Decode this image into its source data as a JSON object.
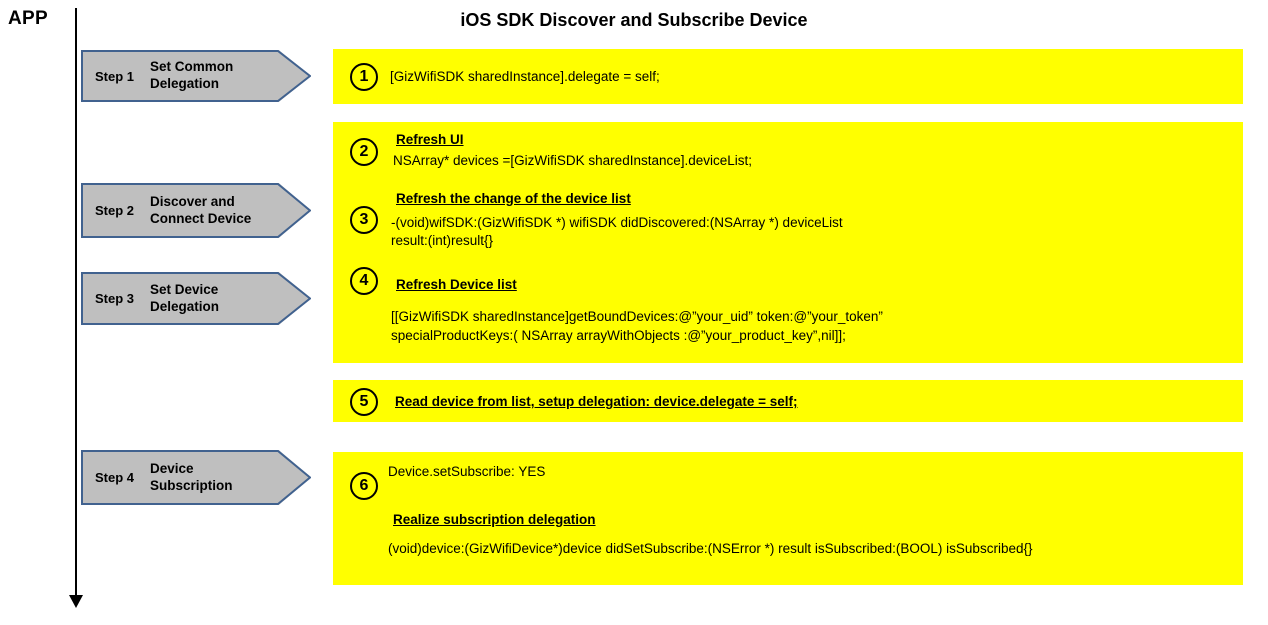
{
  "title": "iOS SDK Discover and Subscribe Device",
  "actor": {
    "label": "APP"
  },
  "colors": {
    "panel_background": "#ffff00",
    "chevron_fill": "#bfbfbf",
    "chevron_border": "#41628f",
    "text": "#000000",
    "lifeline": "#000000"
  },
  "steps": [
    {
      "number": "Step 1",
      "name": "Set Common\nDelegation"
    },
    {
      "number": "Step 2",
      "name": "Discover and\nConnect Device"
    },
    {
      "number": "Step 3",
      "name": "Set Device\nDelegation"
    },
    {
      "number": "Step 4",
      "name": "Device\nSubscription"
    }
  ],
  "panels": [
    {
      "badges": [
        "1"
      ],
      "lines": [
        {
          "text": "[GizWifiSDK sharedInstance].delegate = self;",
          "heading": false
        }
      ]
    },
    {
      "badges": [
        "2",
        "3",
        "4"
      ],
      "lines": [
        {
          "text": "Refresh UI",
          "heading": true
        },
        {
          "text": "NSArray* devices =[GizWifiSDK sharedInstance].deviceList;",
          "heading": false
        },
        {
          "text": "Refresh the change of the device list",
          "heading": true
        },
        {
          "text": "-(void)wifSDK:(GizWifiSDK *) wifiSDK didDiscovered:(NSArray *) deviceList",
          "heading": false
        },
        {
          "text": "result:(int)result{}",
          "heading": false
        },
        {
          "text": "Refresh Device list",
          "heading": true
        },
        {
          "text": "[[GizWifiSDK sharedInstance]getBoundDevices:@”your_uid” token:@”your_token”",
          "heading": false
        },
        {
          "text": "specialProductKeys:( NSArray arrayWithObjects :@”your_product_key”,nil]];",
          "heading": false
        }
      ]
    },
    {
      "badges": [
        "5"
      ],
      "lines": [
        {
          "text": "Read device from list, setup delegation: device.delegate = self;",
          "heading": true
        }
      ]
    },
    {
      "badges": [
        "6"
      ],
      "lines": [
        {
          "text": "Device.setSubscribe: YES",
          "heading": false
        },
        {
          "text": "Realize subscription delegation",
          "heading": true
        },
        {
          "text": "(void)device:(GizWifiDevice*)device didSetSubscribe:(NSError *) result isSubscribed:(BOOL) isSubscribed{}",
          "heading": false
        }
      ]
    }
  ]
}
